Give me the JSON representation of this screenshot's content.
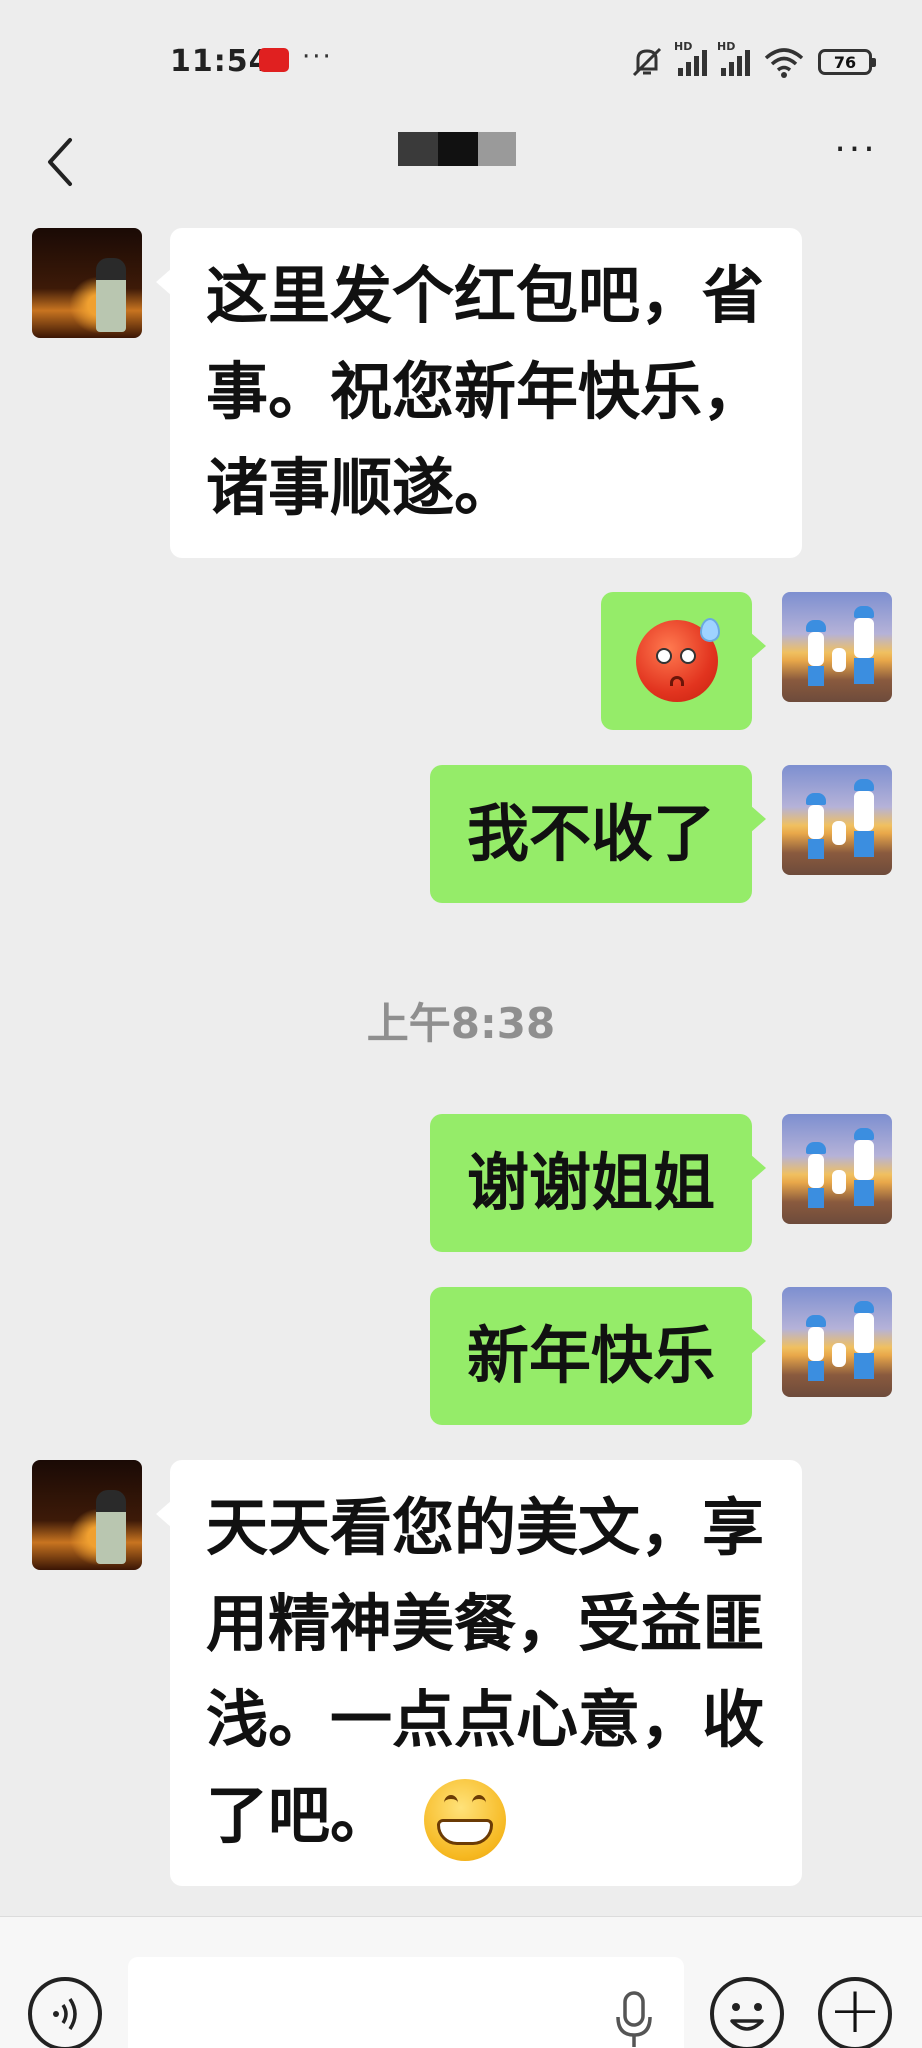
{
  "status_bar": {
    "time": "11:54",
    "more": "···",
    "battery": "76",
    "hd1": "HD",
    "hd2": "HD"
  },
  "header": {
    "menu": "···"
  },
  "messages": [
    {
      "from": "them",
      "text": "这里发个红包吧，省事。祝您新年快乐，诸事顺遂。"
    },
    {
      "from": "me",
      "emoji": "flushed-face-sweat"
    },
    {
      "from": "me",
      "text": "我不收了"
    },
    {
      "type": "timestamp",
      "text": "上午8:38"
    },
    {
      "from": "me",
      "text": "谢谢姐姐"
    },
    {
      "from": "me",
      "text": "新年快乐"
    },
    {
      "from": "them",
      "text": "天天看您的美文，享用精神美餐，受益匪浅。一点点心意，收了吧。",
      "emoji": "grinning-face"
    }
  ],
  "lines": {
    "m1": [
      "这里发个红包吧，省",
      "事。祝您新年快乐，",
      "诸事顺遂。"
    ],
    "m7": [
      "天天看您的美文，享",
      "用精神美餐，受益匪",
      "浅。一点点心意，收",
      "了吧。"
    ]
  },
  "input": {
    "plus": "+"
  },
  "colors": {
    "bg": "#ededed",
    "green_bubble": "#95ec69",
    "white_bubble": "#ffffff",
    "timestamp": "#8f8f8f"
  }
}
